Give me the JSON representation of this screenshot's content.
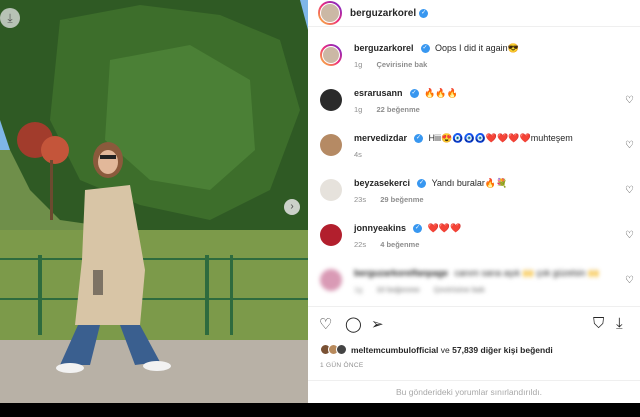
{
  "post": {
    "author": "berguzarkorel",
    "verified_badge": "✓"
  },
  "caption": {
    "username": "berguzarkorel",
    "text": "Oops I did it again😎",
    "time": "1g",
    "translate": "Çevirisine bak"
  },
  "comments": [
    {
      "username": "esrarusann",
      "text": "🔥🔥🔥",
      "time": "1g",
      "likes": "22 beğenme"
    },
    {
      "username": "mervedizdar",
      "text": "Hiii😍🧿🧿🧿❤️❤️❤️❤️muhteşem",
      "time": "4s",
      "likes": ""
    },
    {
      "username": "beyzasekerci",
      "text": "Yandı buralar🔥💐",
      "time": "23s",
      "likes": "29 beğenme"
    },
    {
      "username": "jonnyeakins",
      "text": "❤️❤️❤️",
      "time": "22s",
      "likes": "4 beğenme"
    }
  ],
  "blurred_comment": {
    "username": "berguzarkorelfanpage",
    "text": "canım sana aşık 🙌 çok güzelsin 🙌",
    "time": "1g",
    "likes": "10 beğenme",
    "reply": "Çevirisine bak"
  },
  "icons": {
    "heart": "♡",
    "comment": "◯",
    "share": "➢",
    "save": "⛉",
    "download": "⤓",
    "next": "›"
  },
  "likes": {
    "user": "meltemcumbulofficial",
    "connector": "ve",
    "count": "57,839",
    "suffix": "diğer kişi beğendi"
  },
  "date": "1 GÜN ÖNCE",
  "limited_comments": "Bu gönderideki yorumlar sınırlandırıldı.",
  "colors": {
    "verified": "#3897f0",
    "heart_emoji": "#e0245e",
    "story_ring_start": "#f9ce34",
    "story_ring_end": "#6228d7"
  }
}
